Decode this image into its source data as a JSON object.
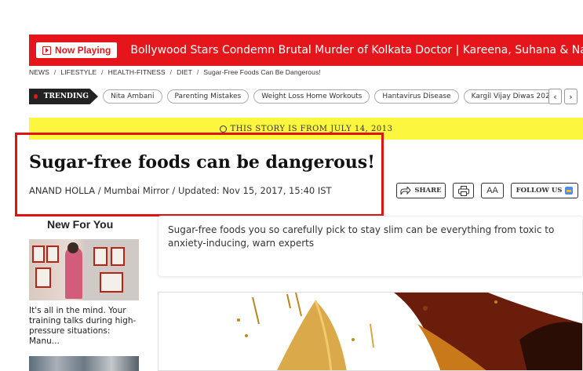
{
  "now_playing": {
    "label": "Now Playing",
    "title": "Bollywood Stars Condemn Brutal Murder of Kolkata Doctor | Kareena, Suhana & Navya"
  },
  "breadcrumb": [
    "NEWS",
    "LIFESTYLE",
    "HEALTH-FITNESS",
    "DIET",
    "Sugar-Free Foods Can Be Dangerous!"
  ],
  "trending": {
    "label": "TRENDING",
    "chips": [
      "Nita Ambani",
      "Parenting Mistakes",
      "Weight Loss Home Workouts",
      "Hantavirus Disease",
      "Kargil Vijay Diwas 202"
    ],
    "prev_icon": "chevron-left-icon",
    "next_icon": "chevron-right-icon"
  },
  "story_banner": "THIS STORY IS FROM JULY 14, 2013",
  "article": {
    "headline": "Sugar-free foods can be dangerous!",
    "byline": "ANAND HOLLA / Mumbai Mirror / Updated: Nov 15, 2017, 15:40 IST",
    "summary": "Sugar-free foods you so carefully pick to stay slim can be everything from toxic to anxiety-inducing, warn experts"
  },
  "actions": {
    "share": "SHARE",
    "font_size": "AA",
    "follow": "FOLLOW US",
    "icons": [
      "share-icon",
      "print-icon",
      "google-news-icon"
    ]
  },
  "new_for_you": {
    "heading": "New For You",
    "items": [
      {
        "caption": "It's all in the mind. Your training talks during high-pressure situations: Manu..."
      }
    ]
  },
  "colors": {
    "brand_red": "#e5161b",
    "banner_yellow": "#fcf63f",
    "highlight_box": "#e01313"
  }
}
